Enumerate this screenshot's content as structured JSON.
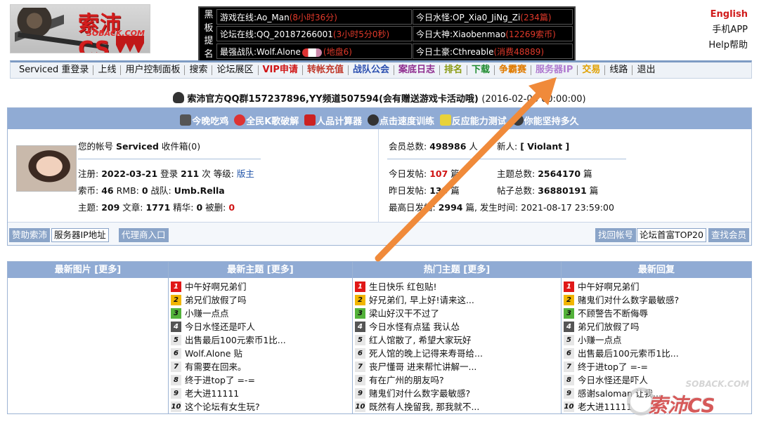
{
  "header": {
    "logo_text": "索沛CS",
    "logo_sub": "SOBACK.COM",
    "blackboard_label": [
      "黑",
      "板",
      "提",
      "名"
    ],
    "blackboard": [
      {
        "label": "游戏在线:Ao_Man",
        "highlight": "(8小时36分)"
      },
      {
        "label": "今日水怪:OP_Xia0_JiNg_Zi",
        "highlight": "(234篇)"
      },
      {
        "label": "论坛在线:QQ_20187266001",
        "highlight": "(3小时5分0秒)"
      },
      {
        "label": "今日大神:Xiaobenmao",
        "highlight": "(12269索币)"
      },
      {
        "label": "最强战队:Wolf.Alone",
        "highlight": "(地盘6)"
      },
      {
        "label": "今日土豪:Cthreable",
        "highlight": "(消费48889)"
      }
    ],
    "links": {
      "language": "English",
      "app": "手机APP",
      "help": "Help帮助"
    }
  },
  "nav": [
    {
      "label": "Serviced 重登录",
      "color": "#111111",
      "bold": false
    },
    {
      "label": "上线",
      "color": "#111111"
    },
    {
      "label": "用户控制面板",
      "color": "#111111"
    },
    {
      "label": "搜索",
      "color": "#111111"
    },
    {
      "label": "论坛展区",
      "color": "#111111"
    },
    {
      "label": "VIP申请",
      "color": "#d01515"
    },
    {
      "label": "转帐充值",
      "color": "#c0392b"
    },
    {
      "label": "战队公会",
      "color": "#2b4fb0"
    },
    {
      "label": "案底日志",
      "color": "#8e2b8e"
    },
    {
      "label": "排名",
      "color": "#8a9a10"
    },
    {
      "label": "下载",
      "color": "#1c8a2c"
    },
    {
      "label": "争霸赛",
      "color": "#e07b00"
    },
    {
      "label": "服务器IP",
      "color": "#b07ad0"
    },
    {
      "label": "交易",
      "color": "#e0a000"
    },
    {
      "label": "线路",
      "color": "#111111"
    },
    {
      "label": "退出",
      "color": "#111111"
    }
  ],
  "notice": {
    "text": "索沛官方QQ群157237896,YY频道507594(会有赠送游戏卡活动哦)",
    "time": "(2016-02-06 00:00:00)"
  },
  "features": [
    "今晚吃鸡",
    "全民K歌破解",
    "人品计算器",
    "点击速度训练",
    "反应能力测试",
    "你能坚持多久"
  ],
  "user": {
    "account_prefix": "您的帐号",
    "username": "Serviced",
    "inbox": "收件箱(0)",
    "reg_label": "注册:",
    "reg_date": "2022-03-21",
    "login_label": "登录",
    "login_count": "211",
    "login_suffix": "次 等级:",
    "level": "版主",
    "coin_label": "索币:",
    "coin": "46",
    "rmb_label": "RMB:",
    "rmb": "0",
    "team_label": "战队:",
    "team": "Umb.Rella",
    "topic_label": "主题:",
    "topics": "209",
    "article_label": "文章:",
    "articles": "1771",
    "essence_label": "精华:",
    "essence": "0",
    "deleted_label": "被删:",
    "deleted": "0"
  },
  "stats": {
    "members_label": "会员总数:",
    "members": "498986",
    "members_unit": "人",
    "newbie_label": "新人:",
    "newbie": "[ Violant ]",
    "today_label": "今日发帖:",
    "today": "107",
    "today_unit": "篇",
    "topics_label": "主题总数:",
    "topics": "2564170",
    "topics_unit": "篇",
    "yesterday_label": "昨日发帖:",
    "yesterday": "133",
    "yesterday_unit": "篇",
    "posts_label": "帖子总数:",
    "posts": "36880191",
    "posts_unit": "篇",
    "record_label": "最高日发帖:",
    "record": "2994",
    "record_suffix": "篇, 发生时间:",
    "record_time": "2021-08-17 23:59:00"
  },
  "footer_buttons": {
    "sponsor": "赞助索沛",
    "server_ip": "服务器IP地址",
    "agent": "代理商入口",
    "recover": "找回帐号",
    "rich": "论坛首富TOP20",
    "find_member": "查找会员"
  },
  "lists": {
    "images": {
      "title": "最新图片 [更多]",
      "items": []
    },
    "new_topics": {
      "title": "最新主题 [更多]",
      "items": [
        "中午好啊兄弟们",
        "弟兄们放假了吗",
        "小赚一点点",
        "今日水怪还是吓人",
        "出售最后100元索币1比...",
        "Wolf.Alone 贴",
        "有需要在回来。",
        "终于进top了 =-=",
        "老大进11111",
        "这个论坛有女生玩?"
      ]
    },
    "hot_topics": {
      "title": "热门主题 [更多]",
      "items": [
        "生日快乐 红包贴!",
        "好兄弟们, 早上好!请来这...",
        "梁山好汉干不过了",
        "今日水怪有点猛 我认怂",
        "红人馆散了, 希望大家玩好",
        "死人馆的晚上记得来寿哥给...",
        "丧尸懂哥 进来帮忙讲解一...",
        "有在广州的朋友吗?",
        "赌鬼们对什么数字最敏感?",
        "既然有人挽留我, 那我就不..."
      ]
    },
    "latest_replies": {
      "title": "最新回复",
      "items": [
        "中午好啊兄弟们",
        "赌鬼们对什么数字最敏感?",
        "不顾警告不断侮辱",
        "弟兄们放假了吗",
        "小赚一点点",
        "出售最后100元索币1比...",
        "终于进top了 =-=",
        "今日水怪还是吓人",
        "感谢saloman 让我...",
        "老大进11111"
      ]
    }
  },
  "watermark": {
    "top": "SOBACK.COM",
    "main": "索沛CS"
  },
  "colors": {
    "accent_blue": "#90abd4",
    "arrow": "#f08a3a",
    "alert_red": "#d01515"
  }
}
